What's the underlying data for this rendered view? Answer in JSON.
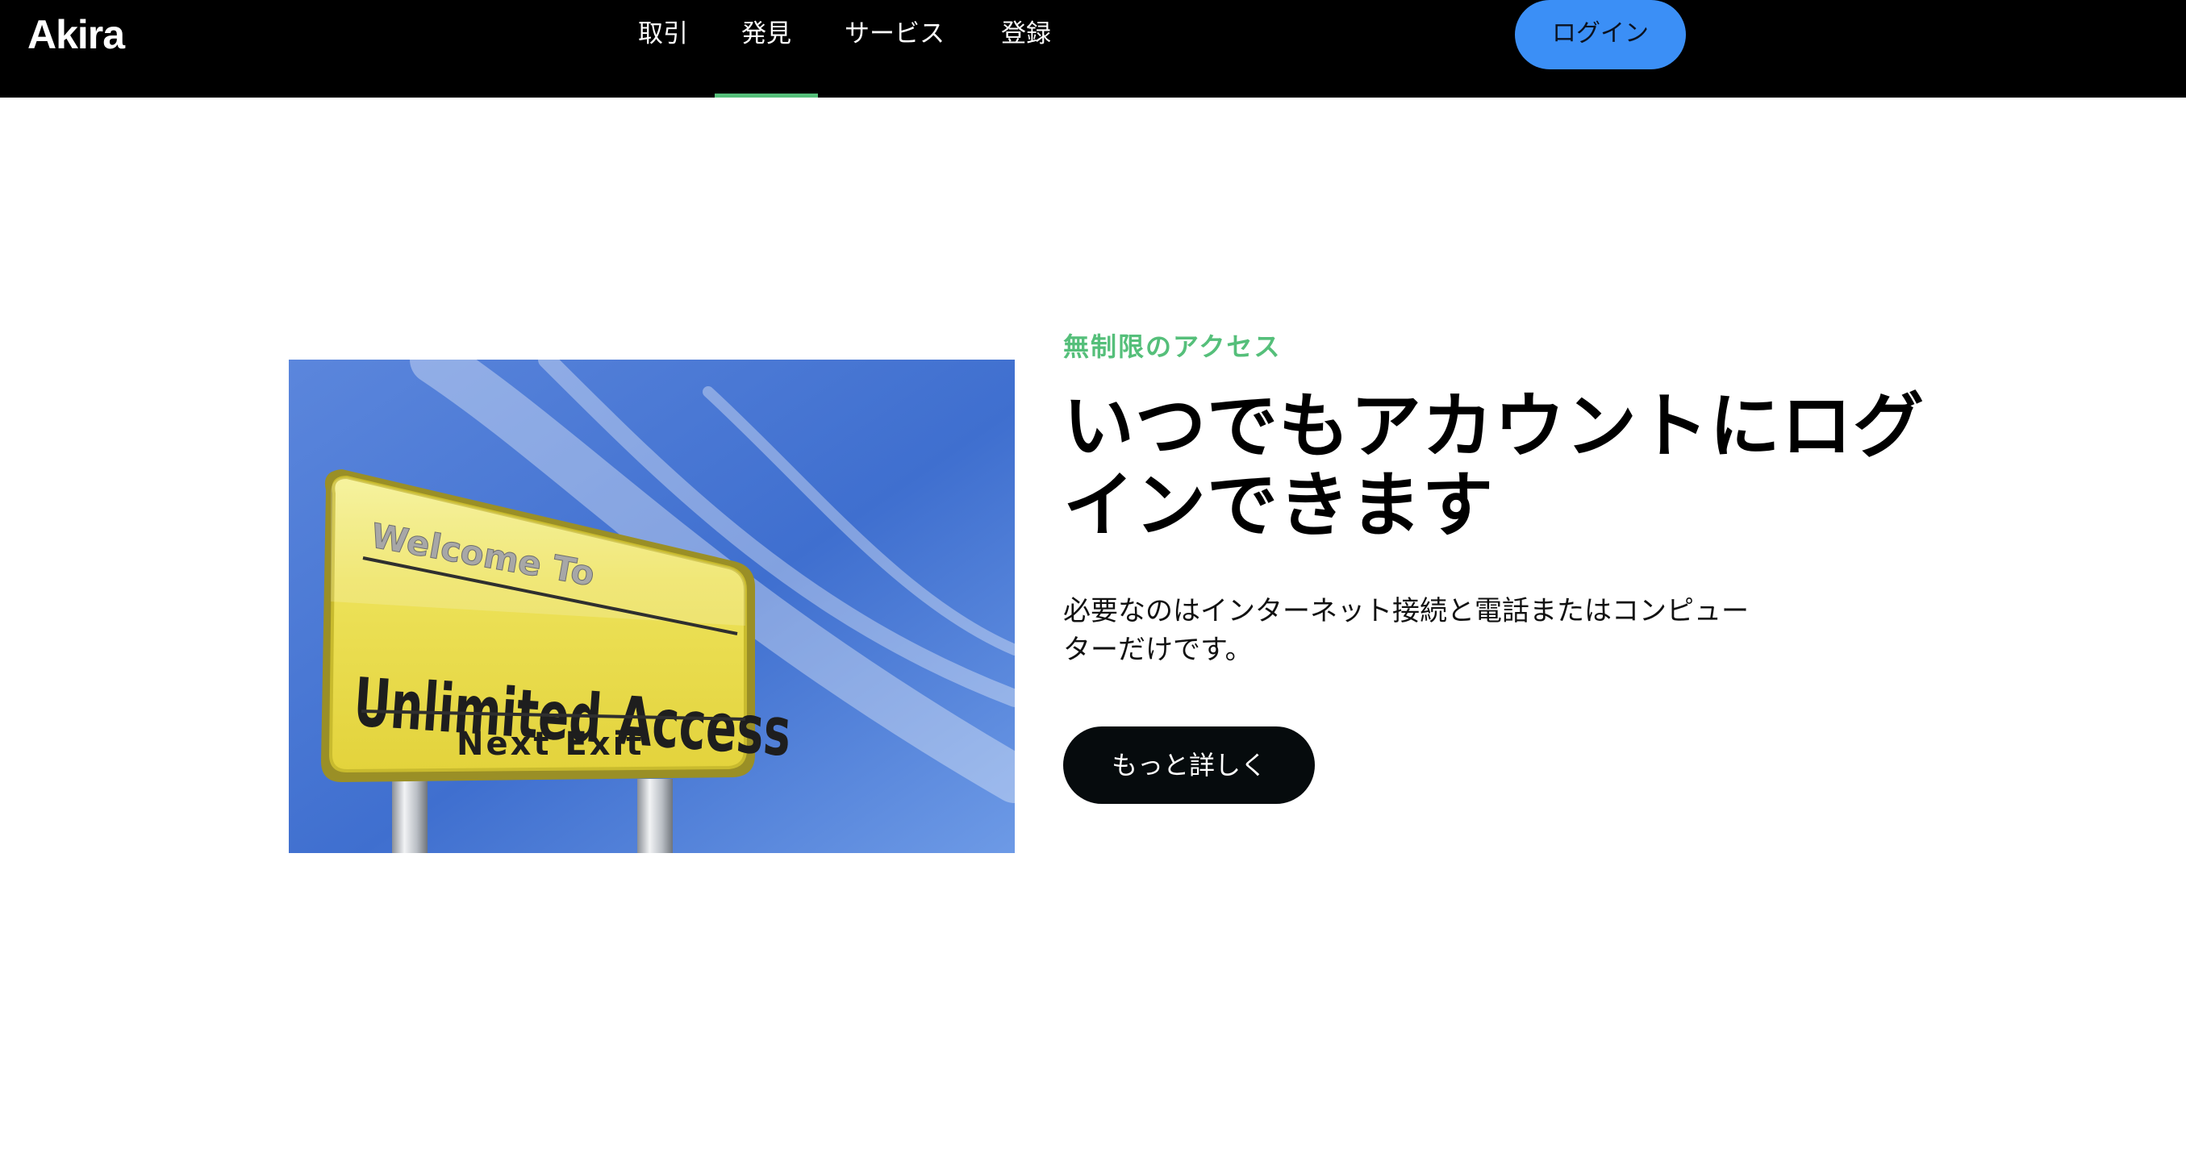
{
  "header": {
    "brand": "Akira",
    "nav": [
      {
        "label": "取引",
        "active": false
      },
      {
        "label": "発見",
        "active": true
      },
      {
        "label": "サービス",
        "active": false
      },
      {
        "label": "登録",
        "active": false
      }
    ],
    "login_label": "ログイン"
  },
  "hero": {
    "eyebrow": "無制限のアクセス",
    "headline": "いつでもアカウントにログインできます",
    "description": "必要なのはインターネット接続と電話またはコンピューターだけです。",
    "cta_label": "もっと詳しく",
    "image": {
      "sign_line_1": "Welcome To",
      "sign_line_2": "Unlimited Access",
      "sign_line_3": "Next Exit"
    }
  },
  "colors": {
    "nav_background": "#000000",
    "accent_green": "#55bf7a",
    "login_blue": "#3b8ff6",
    "cta_background": "#060b0d"
  }
}
